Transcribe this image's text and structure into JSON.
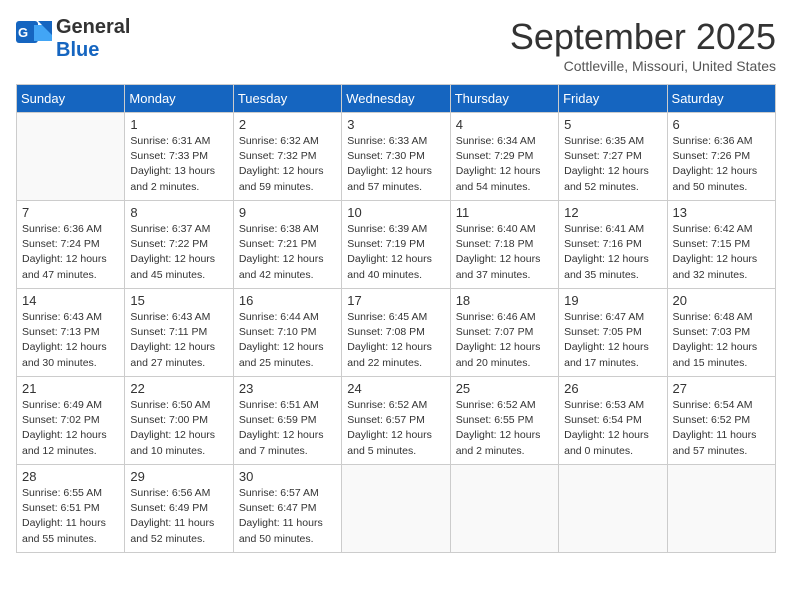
{
  "header": {
    "logo_general": "General",
    "logo_blue": "Blue",
    "month_title": "September 2025",
    "location": "Cottleville, Missouri, United States"
  },
  "weekdays": [
    "Sunday",
    "Monday",
    "Tuesday",
    "Wednesday",
    "Thursday",
    "Friday",
    "Saturday"
  ],
  "weeks": [
    [
      {
        "day": "",
        "info": ""
      },
      {
        "day": "1",
        "info": "Sunrise: 6:31 AM\nSunset: 7:33 PM\nDaylight: 13 hours\nand 2 minutes."
      },
      {
        "day": "2",
        "info": "Sunrise: 6:32 AM\nSunset: 7:32 PM\nDaylight: 12 hours\nand 59 minutes."
      },
      {
        "day": "3",
        "info": "Sunrise: 6:33 AM\nSunset: 7:30 PM\nDaylight: 12 hours\nand 57 minutes."
      },
      {
        "day": "4",
        "info": "Sunrise: 6:34 AM\nSunset: 7:29 PM\nDaylight: 12 hours\nand 54 minutes."
      },
      {
        "day": "5",
        "info": "Sunrise: 6:35 AM\nSunset: 7:27 PM\nDaylight: 12 hours\nand 52 minutes."
      },
      {
        "day": "6",
        "info": "Sunrise: 6:36 AM\nSunset: 7:26 PM\nDaylight: 12 hours\nand 50 minutes."
      }
    ],
    [
      {
        "day": "7",
        "info": "Sunrise: 6:36 AM\nSunset: 7:24 PM\nDaylight: 12 hours\nand 47 minutes."
      },
      {
        "day": "8",
        "info": "Sunrise: 6:37 AM\nSunset: 7:22 PM\nDaylight: 12 hours\nand 45 minutes."
      },
      {
        "day": "9",
        "info": "Sunrise: 6:38 AM\nSunset: 7:21 PM\nDaylight: 12 hours\nand 42 minutes."
      },
      {
        "day": "10",
        "info": "Sunrise: 6:39 AM\nSunset: 7:19 PM\nDaylight: 12 hours\nand 40 minutes."
      },
      {
        "day": "11",
        "info": "Sunrise: 6:40 AM\nSunset: 7:18 PM\nDaylight: 12 hours\nand 37 minutes."
      },
      {
        "day": "12",
        "info": "Sunrise: 6:41 AM\nSunset: 7:16 PM\nDaylight: 12 hours\nand 35 minutes."
      },
      {
        "day": "13",
        "info": "Sunrise: 6:42 AM\nSunset: 7:15 PM\nDaylight: 12 hours\nand 32 minutes."
      }
    ],
    [
      {
        "day": "14",
        "info": "Sunrise: 6:43 AM\nSunset: 7:13 PM\nDaylight: 12 hours\nand 30 minutes."
      },
      {
        "day": "15",
        "info": "Sunrise: 6:43 AM\nSunset: 7:11 PM\nDaylight: 12 hours\nand 27 minutes."
      },
      {
        "day": "16",
        "info": "Sunrise: 6:44 AM\nSunset: 7:10 PM\nDaylight: 12 hours\nand 25 minutes."
      },
      {
        "day": "17",
        "info": "Sunrise: 6:45 AM\nSunset: 7:08 PM\nDaylight: 12 hours\nand 22 minutes."
      },
      {
        "day": "18",
        "info": "Sunrise: 6:46 AM\nSunset: 7:07 PM\nDaylight: 12 hours\nand 20 minutes."
      },
      {
        "day": "19",
        "info": "Sunrise: 6:47 AM\nSunset: 7:05 PM\nDaylight: 12 hours\nand 17 minutes."
      },
      {
        "day": "20",
        "info": "Sunrise: 6:48 AM\nSunset: 7:03 PM\nDaylight: 12 hours\nand 15 minutes."
      }
    ],
    [
      {
        "day": "21",
        "info": "Sunrise: 6:49 AM\nSunset: 7:02 PM\nDaylight: 12 hours\nand 12 minutes."
      },
      {
        "day": "22",
        "info": "Sunrise: 6:50 AM\nSunset: 7:00 PM\nDaylight: 12 hours\nand 10 minutes."
      },
      {
        "day": "23",
        "info": "Sunrise: 6:51 AM\nSunset: 6:59 PM\nDaylight: 12 hours\nand 7 minutes."
      },
      {
        "day": "24",
        "info": "Sunrise: 6:52 AM\nSunset: 6:57 PM\nDaylight: 12 hours\nand 5 minutes."
      },
      {
        "day": "25",
        "info": "Sunrise: 6:52 AM\nSunset: 6:55 PM\nDaylight: 12 hours\nand 2 minutes."
      },
      {
        "day": "26",
        "info": "Sunrise: 6:53 AM\nSunset: 6:54 PM\nDaylight: 12 hours\nand 0 minutes."
      },
      {
        "day": "27",
        "info": "Sunrise: 6:54 AM\nSunset: 6:52 PM\nDaylight: 11 hours\nand 57 minutes."
      }
    ],
    [
      {
        "day": "28",
        "info": "Sunrise: 6:55 AM\nSunset: 6:51 PM\nDaylight: 11 hours\nand 55 minutes."
      },
      {
        "day": "29",
        "info": "Sunrise: 6:56 AM\nSunset: 6:49 PM\nDaylight: 11 hours\nand 52 minutes."
      },
      {
        "day": "30",
        "info": "Sunrise: 6:57 AM\nSunset: 6:47 PM\nDaylight: 11 hours\nand 50 minutes."
      },
      {
        "day": "",
        "info": ""
      },
      {
        "day": "",
        "info": ""
      },
      {
        "day": "",
        "info": ""
      },
      {
        "day": "",
        "info": ""
      }
    ]
  ]
}
